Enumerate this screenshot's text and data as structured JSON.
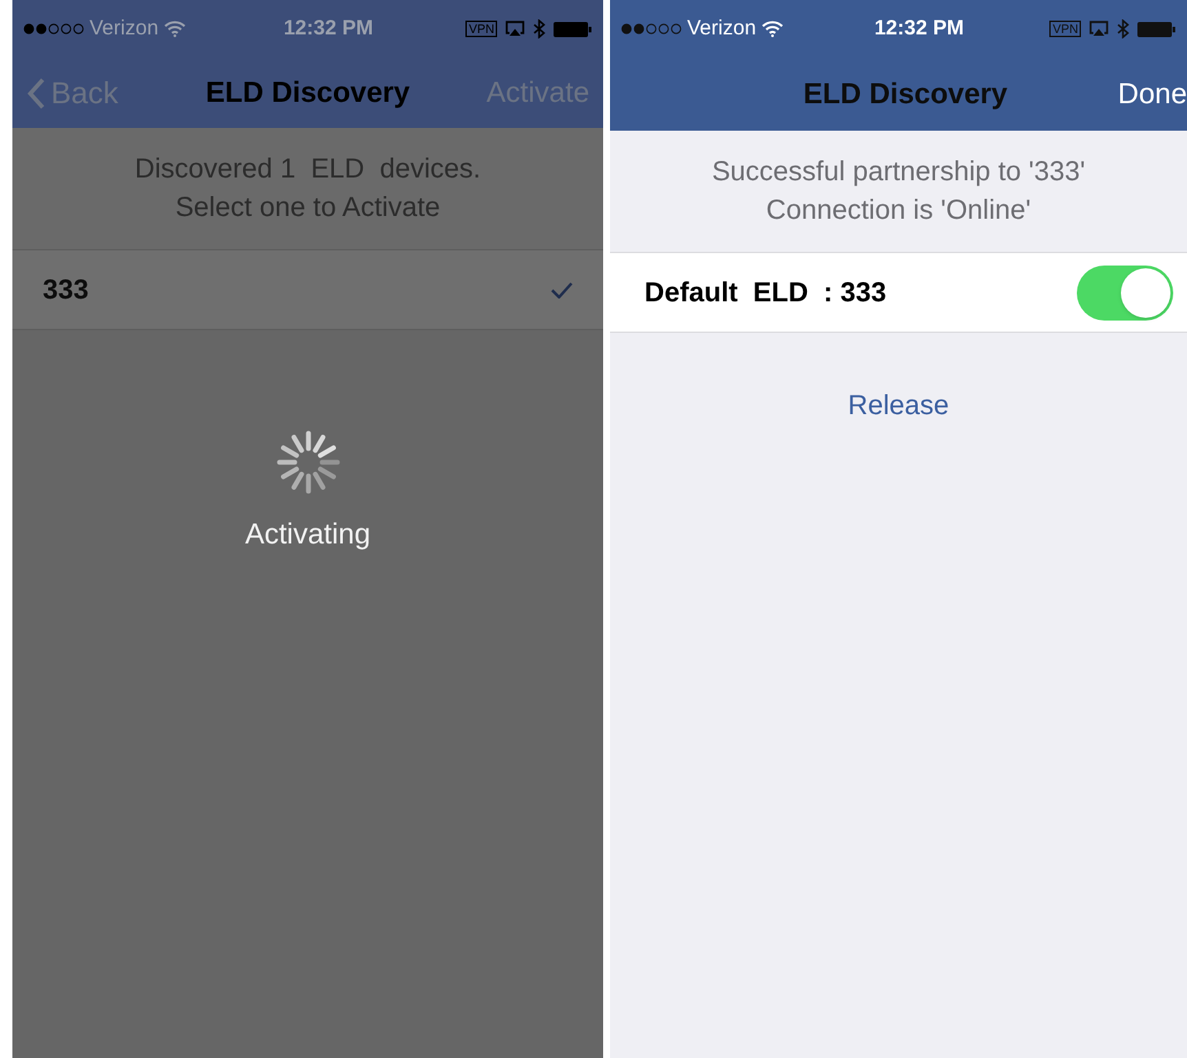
{
  "screens": [
    {
      "kind": "activating",
      "status_bar": {
        "carrier": "Verizon",
        "time": "12:32 PM",
        "vpn": "VPN"
      },
      "nav": {
        "back": "Back",
        "title": "ELD Discovery",
        "action": "Activate"
      },
      "message": [
        "Discovered 1  ELD  devices.",
        "Select one to Activate"
      ],
      "devices": [
        {
          "name": "333",
          "selected": true
        }
      ],
      "overlay": {
        "label": "Activating"
      }
    },
    {
      "kind": "connected",
      "status_bar": {
        "carrier": "Verizon",
        "time": "12:32 PM",
        "vpn": "VPN"
      },
      "nav": {
        "title": "ELD Discovery",
        "action": "Done"
      },
      "message": [
        "Successful partnership to '333'",
        "Connection is 'Online'"
      ],
      "default_row": {
        "label": "Default  ELD  : 333",
        "on": true
      },
      "release": "Release"
    }
  ]
}
